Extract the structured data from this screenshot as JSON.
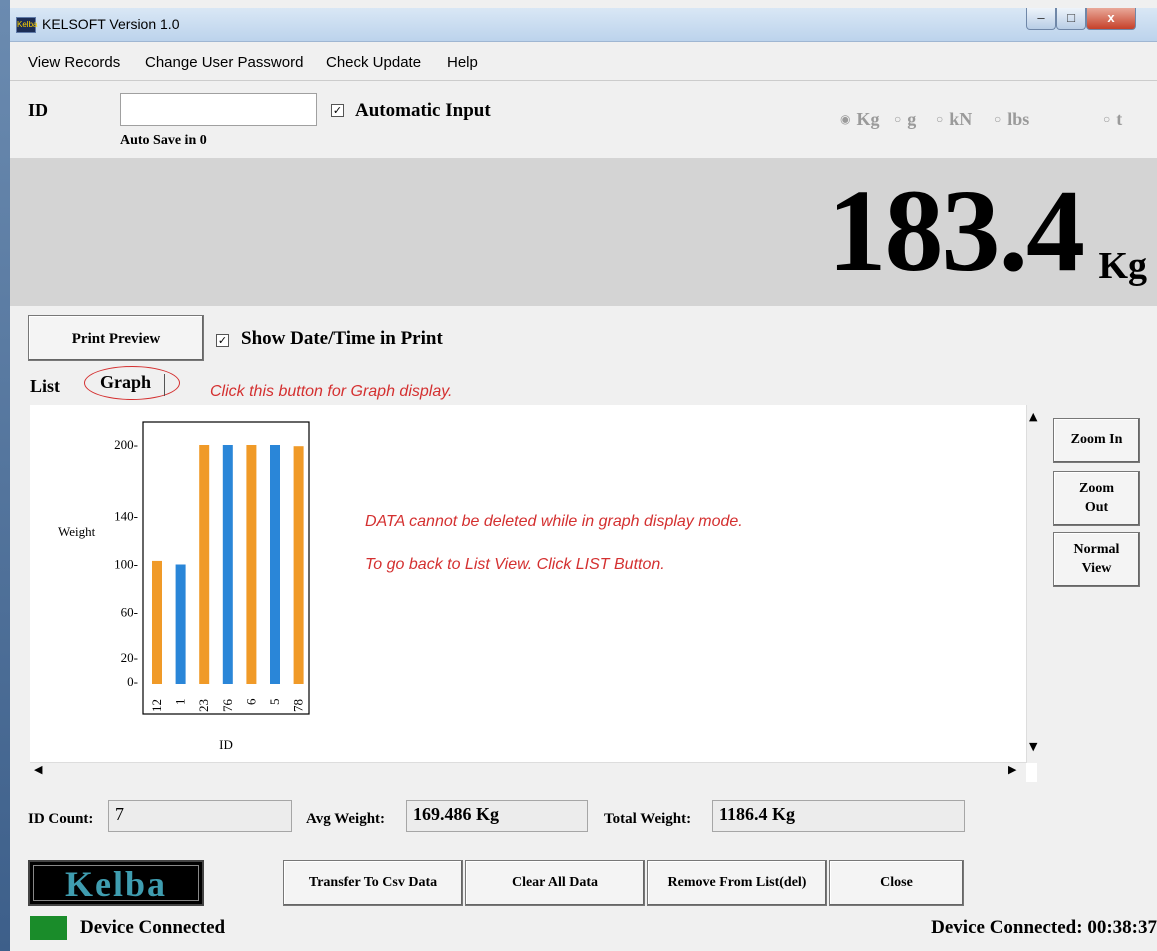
{
  "window": {
    "title": "KELSOFT Version 1.0",
    "icon_text": "Kelba",
    "controls": {
      "minimize": "–",
      "maximize": "□",
      "close": "x"
    }
  },
  "menu": [
    "View Records",
    "Change User Password",
    "Check Update",
    "Help"
  ],
  "input_panel": {
    "id_label": "ID",
    "id_value": "",
    "autosave": "Auto Save in 0",
    "automatic_input_label": "Automatic Input",
    "automatic_input_checked": true,
    "units": [
      {
        "label": "Kg",
        "selected": true
      },
      {
        "label": "g",
        "selected": false
      },
      {
        "label": "kN",
        "selected": false
      },
      {
        "label": "lbs",
        "selected": false
      },
      {
        "label": "t",
        "selected": false
      }
    ]
  },
  "display": {
    "weight": "183.4",
    "unit": "Kg"
  },
  "print": {
    "preview_label": "Print Preview",
    "show_datetime_label": "Show Date/Time in Print",
    "show_datetime_checked": true
  },
  "tabs": {
    "list": "List",
    "graph": "Graph"
  },
  "hint": "Click this button for Graph display.",
  "messages": {
    "line1": "DATA cannot be deleted while in graph display mode.",
    "line2": "To go back to List View. Click LIST Button."
  },
  "chart_data": {
    "type": "bar",
    "xlabel": "ID",
    "ylabel": "Weight",
    "categories": [
      "12",
      "1",
      "23",
      "76",
      "6",
      "5",
      "78"
    ],
    "values": [
      103,
      100,
      200,
      200,
      200,
      200,
      199
    ],
    "colors": [
      "#f09a28",
      "#2a86d8",
      "#f09a28",
      "#2a86d8",
      "#f09a28",
      "#2a86d8",
      "#f09a28"
    ],
    "yticks": [
      "200-",
      "140-",
      "100-",
      "60-",
      "20-",
      "0-"
    ],
    "ylim": [
      0,
      200
    ]
  },
  "side_buttons": {
    "zoom_in": "Zoom In",
    "zoom_out": "Zoom Out",
    "normal_view": "Normal View"
  },
  "stats": {
    "id_count_label": "ID Count:",
    "id_count": "7",
    "avg_label": "Avg Weight:",
    "avg": "169.486 Kg",
    "total_label": "Total Weight:",
    "total": "1186.4 Kg"
  },
  "logo_text": "Kelba",
  "actions": {
    "transfer": "Transfer To Csv Data",
    "clear": "Clear All Data",
    "remove": "Remove From List(del)",
    "close": "Close"
  },
  "status": {
    "left": "Device Connected",
    "right": "Device Connected: 00:38:37",
    "led_color": "#1a8c2a"
  }
}
